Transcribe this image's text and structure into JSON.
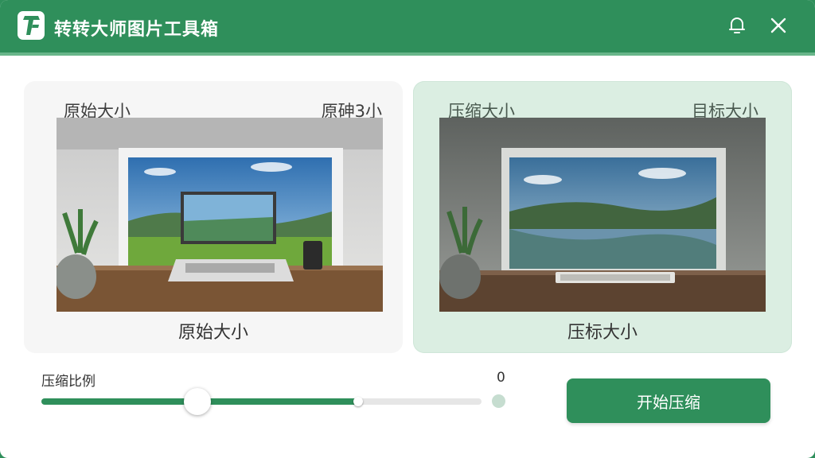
{
  "window": {
    "title": "转转大师图片工具箱",
    "accent_color": "#2f8f5b",
    "icons": [
      "app-logo-icon",
      "bell-icon",
      "close-icon"
    ]
  },
  "preview": {
    "original": {
      "top_left_label": "原始大小",
      "top_right_label": "原砷3小",
      "bottom_label": "原始大小"
    },
    "compressed": {
      "top_left_label": "压缩大小",
      "top_right_label": "目标大小",
      "bottom_label": "压标大小"
    }
  },
  "compression": {
    "label": "压缩比例",
    "value": "0",
    "slider_fraction": 0.72
  },
  "actions": {
    "start_label": "开始压缩"
  }
}
